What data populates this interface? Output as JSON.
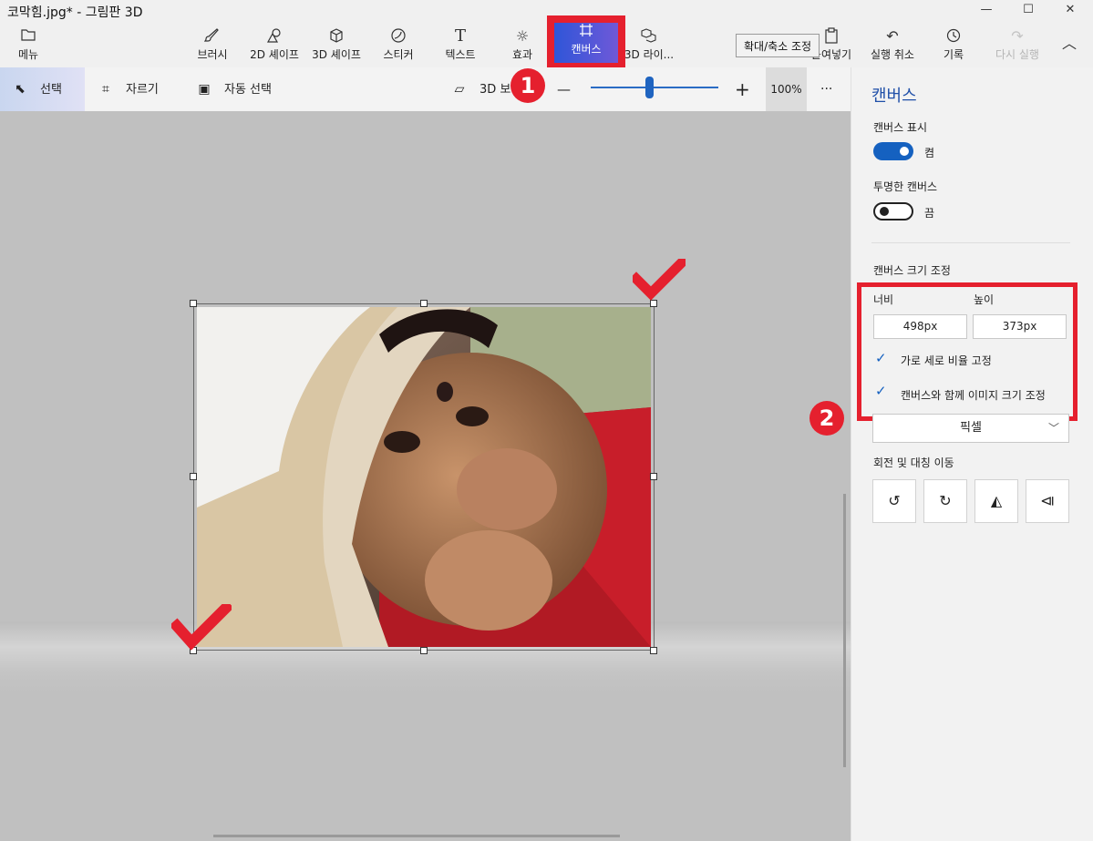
{
  "window": {
    "title": "코막힘.jpg* - 그림판 3D",
    "minimize": "—",
    "maximize": "☐",
    "close": "✕"
  },
  "ribbon": {
    "menu": "메뉴",
    "brush": "브러시",
    "shapes2d": "2D 셰이프",
    "shapes3d": "3D 셰이프",
    "sticker": "스티커",
    "text": "텍스트",
    "effects": "효과",
    "canvas": "캔버스",
    "library3d": "3D 라이...",
    "paste": "붙여넣기",
    "undo": "실행 취소",
    "history": "기록",
    "redo": "다시 실행",
    "tooltip": "확대/축소 조정"
  },
  "toolbar": {
    "select": "선택",
    "crop": "자르기",
    "magic_select": "자동 선택",
    "view3d": "3D 보",
    "zoom_minus": "—",
    "zoom_plus": "+",
    "zoom_percent": "100%",
    "more": "···",
    "zoom_level": 0.46
  },
  "panel": {
    "title": "캔버스",
    "show_canvas_label": "캔버스 표시",
    "show_canvas_state": "켬",
    "transparent_label": "투명한 캔버스",
    "transparent_state": "끔",
    "resize_label": "캔버스 크기 조정",
    "width_label": "너비",
    "height_label": "높이",
    "width_value": "498px",
    "height_value": "373px",
    "lock_aspect": "가로 세로 비율 고정",
    "resize_image": "캔버스와 함께 이미지 크기 조정",
    "unit": "픽셀",
    "rotate_label": "회전 및 대칭 이동"
  },
  "markers": {
    "step1": "1",
    "step2": "2"
  },
  "colors": {
    "accent": "#1561c0",
    "highlight": "#e5202e"
  }
}
